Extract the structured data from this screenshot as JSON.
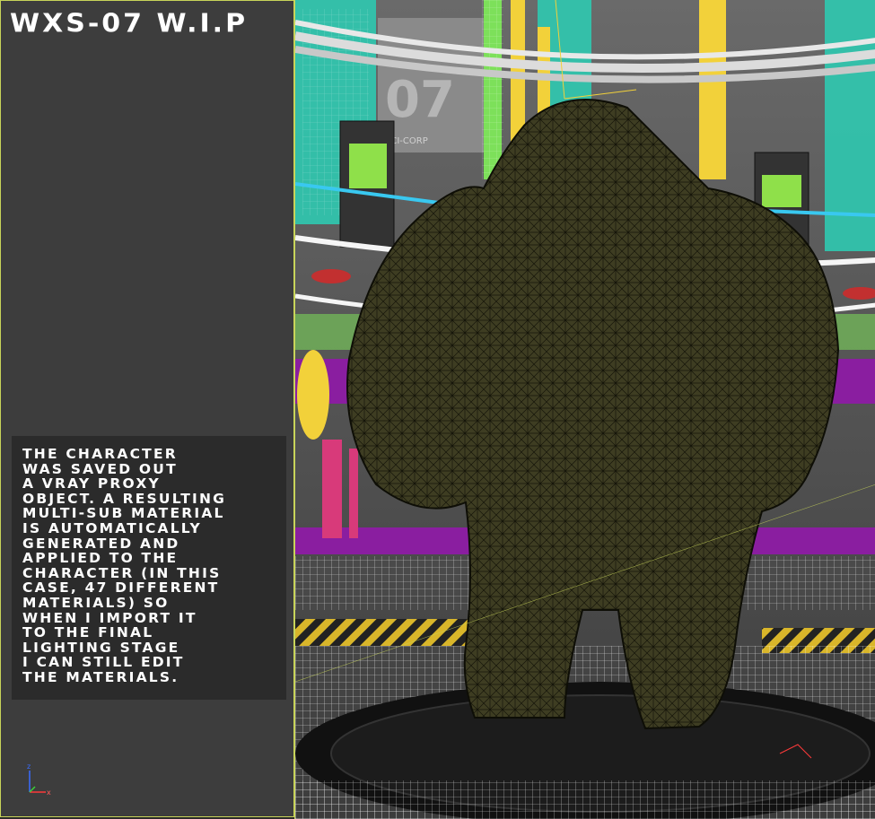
{
  "panel": {
    "title": "WXS-07 W.I.P",
    "note": "The character\nwas saved out\na Vray proxy\nobject. A resulting\nmulti-sub material\nis automatically\ngenerated and\napplied to the\ncharacter (in this\ncase, 47 different\nmaterials) so\nwhen I import it\nto the final\nlighting stage\nI can still edit\nthe materials."
  },
  "gizmo": {
    "z_label": "z",
    "x_label": "x"
  },
  "viewport": {
    "wall_sign_top": "07",
    "wall_sign_brand": "SCI-CORP",
    "colors": {
      "frame_accent": "#c8d45a",
      "wireframe_cyan": "#39e6c9",
      "wireframe_yellow": "#f2d13a",
      "wireframe_green": "#7de05a",
      "wireframe_purple": "#8a1ea0",
      "wireframe_magenta": "#d83a7a",
      "character_mesh": "#3e3d22",
      "screen_green": "#8fe04a"
    }
  }
}
